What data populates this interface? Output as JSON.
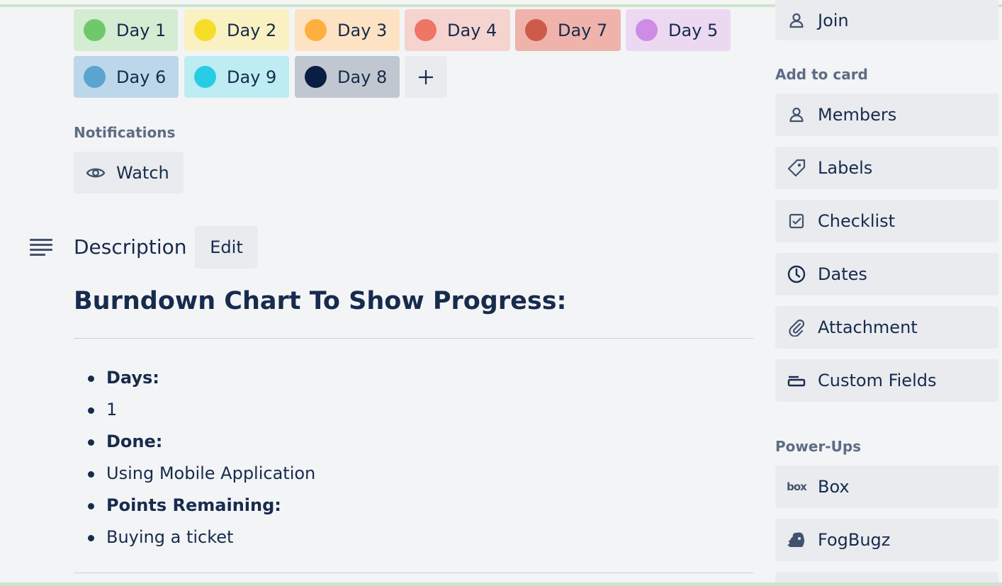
{
  "labels": [
    {
      "text": "Day 1",
      "bg": "#d3ecd2",
      "dot": "#6fc96b"
    },
    {
      "text": "Day 2",
      "bg": "#f9f1c1",
      "dot": "#f5dd29"
    },
    {
      "text": "Day 3",
      "bg": "#fde3c4",
      "dot": "#ffaf3f"
    },
    {
      "text": "Day 4",
      "bg": "#f5d3cf",
      "dot": "#ef7564"
    },
    {
      "text": "Day 7",
      "bg": "#efb3ab",
      "dot": "#cd5a4b"
    },
    {
      "text": "Day 5",
      "bg": "#ecd9f1",
      "dot": "#cd8de5"
    },
    {
      "text": "Day 6",
      "bg": "#bdd7ea",
      "dot": "#5ba4cf"
    },
    {
      "text": "Day 9",
      "bg": "#bdecf3",
      "dot": "#29cce5"
    },
    {
      "text": "Day 8",
      "bg": "#c1c7d0",
      "dot": "#091e42"
    }
  ],
  "notifications": {
    "title": "Notifications",
    "watch_label": "Watch"
  },
  "description": {
    "title": "Description",
    "edit_label": "Edit",
    "heading": "Burndown Chart To Show Progress:",
    "bullets": [
      {
        "text": "Days:",
        "bold": true
      },
      {
        "text": "1",
        "bold": false
      },
      {
        "text": "Done:",
        "bold": true
      },
      {
        "text": "Using Mobile Application",
        "bold": false
      },
      {
        "text": "Points Remaining:",
        "bold": true
      },
      {
        "text": "Buying a ticket",
        "bold": false
      }
    ]
  },
  "sidebar": {
    "join_label": "Join",
    "add_to_card_title": "Add to card",
    "add_to_card": [
      {
        "label": "Members",
        "icon": "person-icon"
      },
      {
        "label": "Labels",
        "icon": "tag-icon"
      },
      {
        "label": "Checklist",
        "icon": "checklist-icon"
      },
      {
        "label": "Dates",
        "icon": "clock-icon"
      },
      {
        "label": "Attachment",
        "icon": "paperclip-icon"
      },
      {
        "label": "Custom Fields",
        "icon": "custom-fields-icon"
      }
    ],
    "powerups_title": "Power-Ups",
    "powerups": [
      {
        "label": "Box",
        "icon": "box-logo-icon",
        "icon_text": "box"
      },
      {
        "label": "FogBugz",
        "icon": "fogbugz-logo-icon"
      }
    ]
  }
}
